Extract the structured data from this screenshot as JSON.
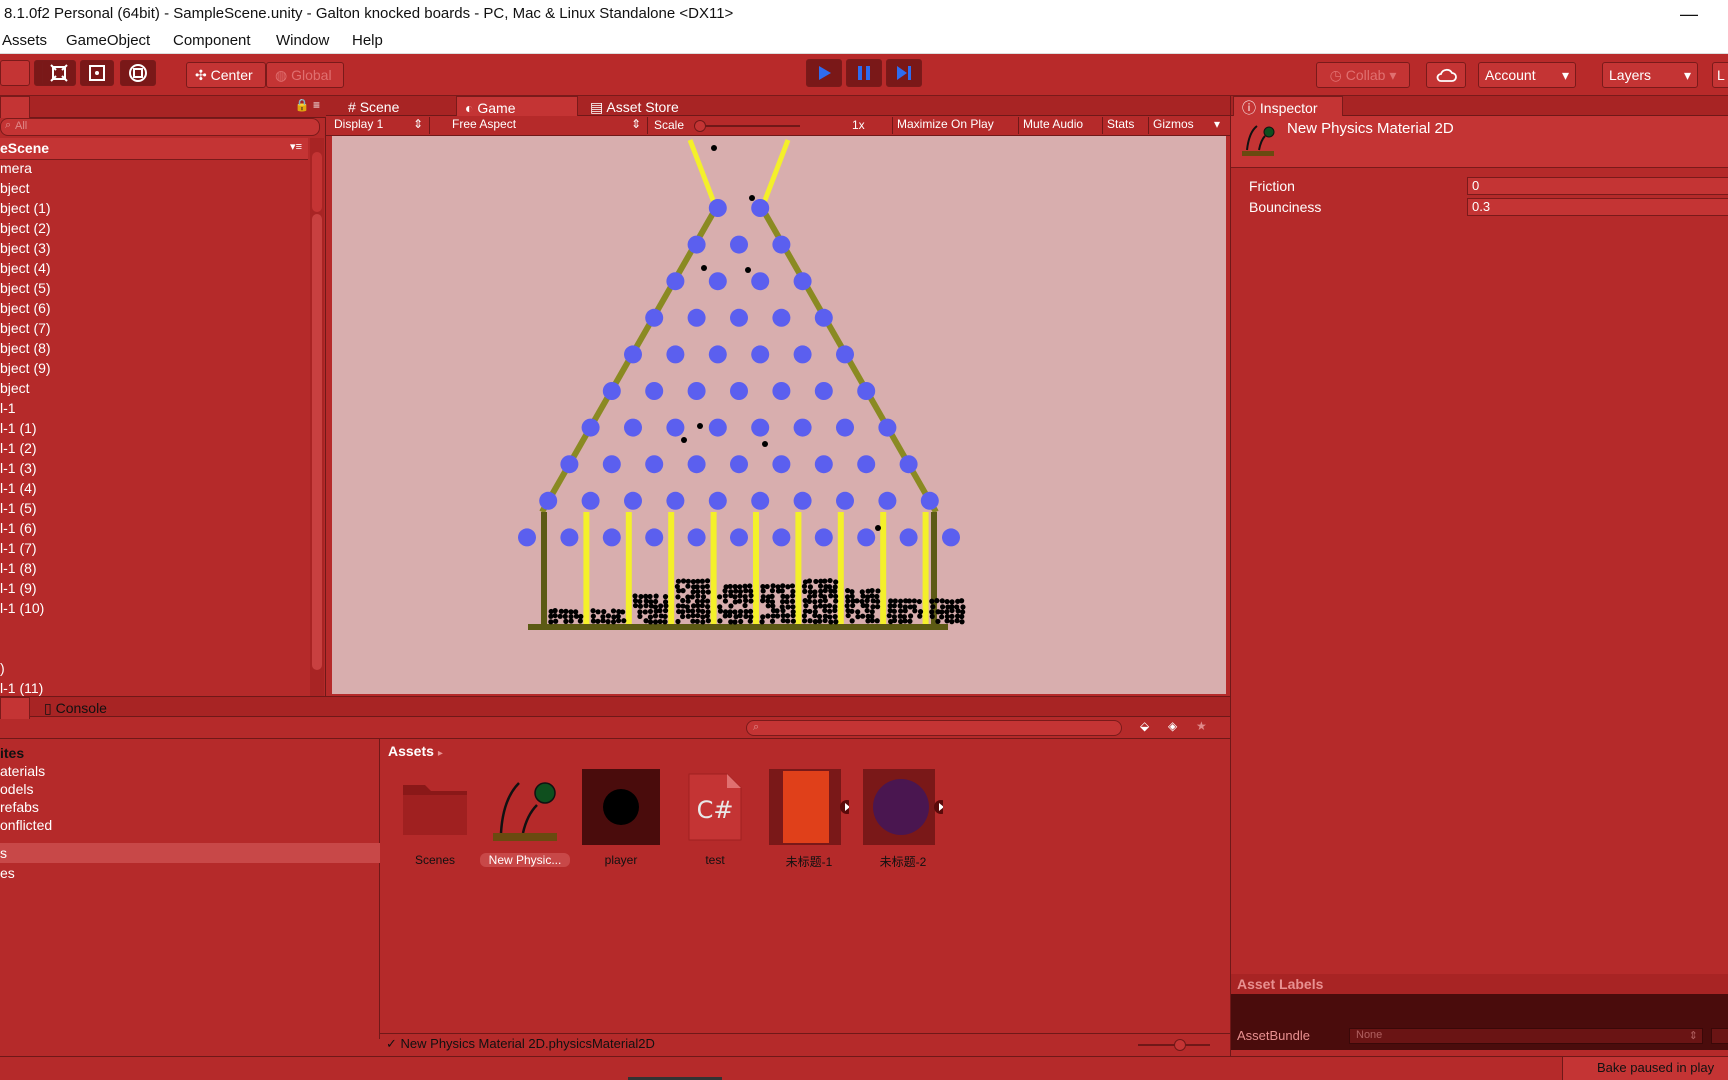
{
  "window": {
    "title": "8.1.0f2 Personal (64bit) - SampleScene.unity - Galton knocked boards - PC, Mac & Linux Standalone <DX11>",
    "minimize_glyph": "—"
  },
  "menu": [
    "Assets",
    "GameObject",
    "Component",
    "Window",
    "Help"
  ],
  "toolbar": {
    "pivot_center": "Center",
    "pivot_global": "Global",
    "collab": "Collab",
    "account": "Account",
    "layers": "Layers",
    "layout_partial": "L"
  },
  "hierarchy": {
    "search_placeholder": "All",
    "scene_name": "eScene",
    "items": [
      "mera",
      "bject",
      "bject (1)",
      "bject (2)",
      "bject (3)",
      "bject (4)",
      "bject (5)",
      "bject (6)",
      "bject (7)",
      "bject (8)",
      "bject (9)",
      "bject",
      "l-1",
      "l-1 (1)",
      "l-1 (2)",
      "l-1 (3)",
      "l-1 (4)",
      "l-1 (5)",
      "l-1 (6)",
      "l-1 (7)",
      "l-1 (8)",
      "l-1 (9)",
      "l-1 (10)",
      "",
      "",
      ")",
      "l-1 (11)"
    ]
  },
  "center_tabs": {
    "scene": "Scene",
    "game": "Game",
    "asset_store": "Asset Store"
  },
  "game_bar": {
    "display": "Display 1",
    "aspect": "Free Aspect",
    "scale_label": "Scale",
    "scale_value": "1x",
    "maximize": "Maximize On Play",
    "mute": "Mute Audio",
    "stats": "Stats",
    "gizmos": "Gizmos"
  },
  "inspector": {
    "tab": "Inspector",
    "object_name": "New Physics Material 2D",
    "fields": [
      {
        "label": "Friction",
        "value": "0"
      },
      {
        "label": "Bounciness",
        "value": "0.3"
      }
    ],
    "asset_labels": "Asset Labels",
    "asset_bundle_label": "AssetBundle",
    "asset_bundle_value": "None"
  },
  "bottom_tabs": {
    "console": "Console"
  },
  "project": {
    "breadcrumb": "Assets",
    "tree": [
      "ites",
      "aterials",
      "odels",
      "refabs",
      "onflicted",
      "s",
      "es"
    ],
    "assets": [
      {
        "name": "Scenes",
        "kind": "folder"
      },
      {
        "name": "New Physic...",
        "kind": "physics"
      },
      {
        "name": "player",
        "kind": "player"
      },
      {
        "name": "test",
        "kind": "script"
      },
      {
        "name": "未标题-1",
        "kind": "sprite-orange"
      },
      {
        "name": "未标题-2",
        "kind": "sprite-purple"
      }
    ],
    "selected_path": "New Physics Material 2D.physicsMaterial2D"
  },
  "status": {
    "message": "Bake paused in play"
  },
  "colors": {
    "peg": "#5b5fef",
    "yellow_bar": "#f4f02a",
    "frame": "#8a8a22",
    "frame_dark": "#5c5a14",
    "game_bg": "#d8aeae",
    "panel_red": "#b52a2a"
  }
}
